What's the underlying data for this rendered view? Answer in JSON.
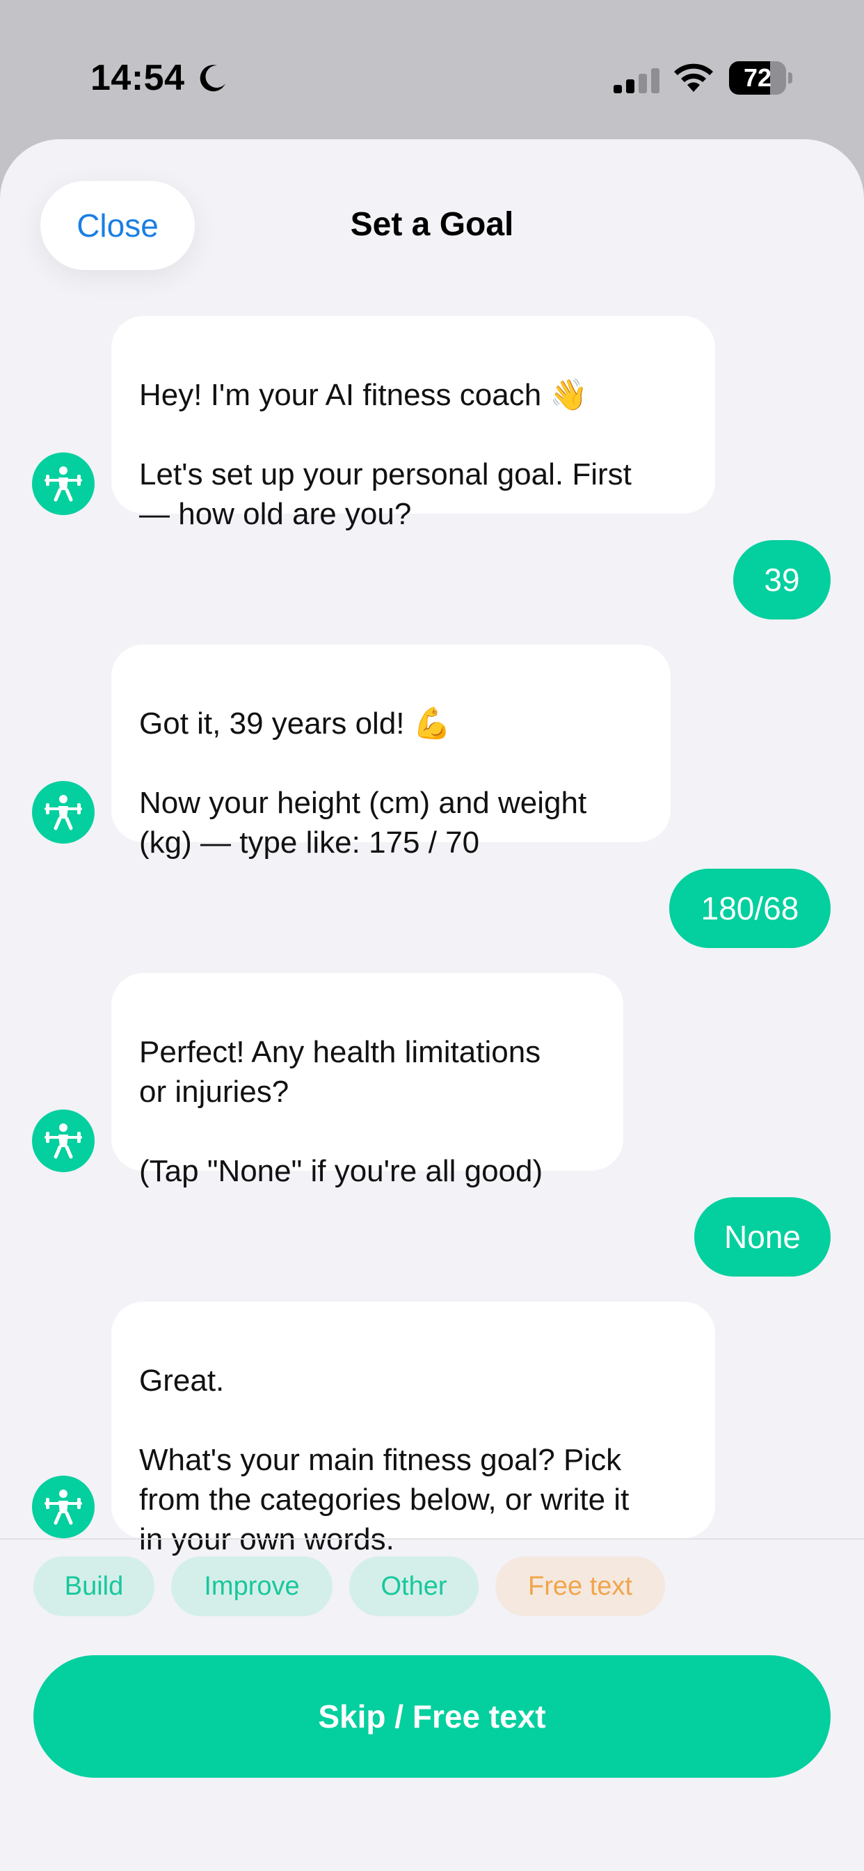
{
  "status_bar": {
    "time": "14:54",
    "battery": "72",
    "battery_level": 0.72,
    "icons": [
      "moon-icon",
      "cellular-signal-icon",
      "wifi-icon",
      "battery-icon"
    ]
  },
  "header": {
    "close_label": "Close",
    "title": "Set a Goal"
  },
  "messages": [
    {
      "from": "bot",
      "text": "Hey! I'm your AI fitness coach",
      "emoji": "👋",
      "text2": "Let's set up your personal goal. First\n— how old are you?"
    },
    {
      "from": "user",
      "text": "39"
    },
    {
      "from": "bot",
      "text": "Got it, 39 years old!",
      "emoji": "💪",
      "text2": "Now your height (cm) and weight\n(kg) — type like: 175 / 70"
    },
    {
      "from": "user",
      "text": "180/68"
    },
    {
      "from": "bot",
      "text": "Perfect! Any health limitations\nor injuries?",
      "emoji": "",
      "text2": "(Tap \"None\" if you're all good)"
    },
    {
      "from": "user",
      "text": "None"
    },
    {
      "from": "bot",
      "text": "Great.",
      "emoji": "",
      "text2": "What's your main fitness goal? Pick\nfrom the categories below, or write it\nin your own words."
    }
  ],
  "quick_replies": [
    "Build",
    "Improve",
    "Other",
    "Free text"
  ],
  "skip_button": "Skip / Free text",
  "colors": {
    "accent": "#04cf9e",
    "link": "#1a7fe3",
    "chip_bg": "#d4efe9",
    "free_text_chip": "#f0a54b",
    "background": "#f2f2f7"
  },
  "avatar_icon": "weightlifter-icon"
}
